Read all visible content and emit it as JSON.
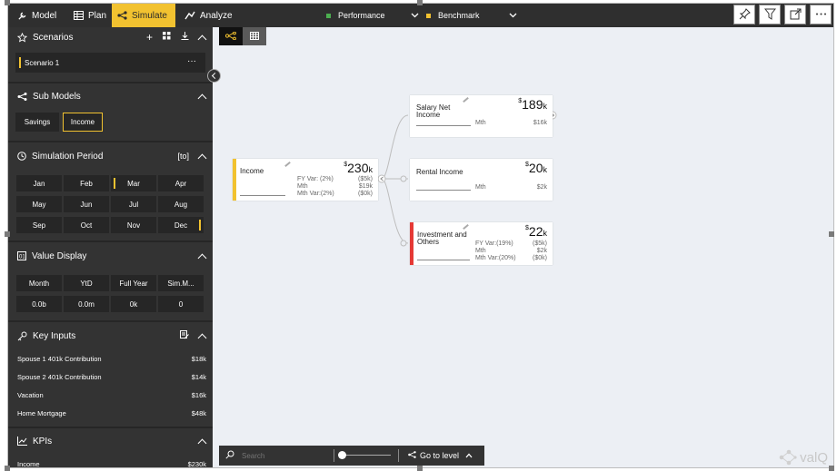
{
  "tabs": [
    {
      "label": "Model",
      "icon": "wrench-icon"
    },
    {
      "label": "Plan",
      "icon": "table-icon"
    },
    {
      "label": "Simulate",
      "icon": "simulate-icon",
      "active": true
    },
    {
      "label": "Analyze",
      "icon": "analyze-icon"
    }
  ],
  "scenario_selectors": [
    {
      "label": "Performance",
      "color": "#4caf50"
    },
    {
      "label": "Benchmark",
      "color": "#f2c230"
    }
  ],
  "toolbar_icons": [
    "pin-icon",
    "filter-icon",
    "expand-icon",
    "more-icon"
  ],
  "scenarios": {
    "title": "Scenarios",
    "item": "Scenario 1",
    "item_menu": "···"
  },
  "sub_models": {
    "title": "Sub Models",
    "items": [
      "Savings",
      "Income"
    ],
    "selected": "Income"
  },
  "simulation_period": {
    "title": "Simulation Period",
    "badge": "[to]",
    "months": [
      "Jan",
      "Feb",
      "Mar",
      "Apr",
      "May",
      "Jun",
      "Jul",
      "Aug",
      "Sep",
      "Oct",
      "Nov",
      "Dec"
    ],
    "range_start": "Mar",
    "range_end": "Dec"
  },
  "value_display": {
    "title": "Value Display",
    "headers": [
      "Month",
      "YtD",
      "Full Year",
      "Sim.M..."
    ],
    "values": [
      "0.0b",
      "0.0m",
      "0k",
      "0"
    ],
    "selected": "Full Year"
  },
  "key_inputs": {
    "title": "Key Inputs",
    "items": [
      {
        "label": "Spouse 1 401k Contribution",
        "value": "$18k"
      },
      {
        "label": "Spouse 2 401k Contribution",
        "value": "$14k"
      },
      {
        "label": "Vacation",
        "value": "$16k"
      },
      {
        "label": "Home Mortgage",
        "value": "$48k"
      }
    ]
  },
  "kpis": {
    "title": "KPIs",
    "items": [
      {
        "label": "Income",
        "value": "$230k"
      }
    ]
  },
  "nodes": {
    "income": {
      "name": "Income",
      "currency": "$",
      "value": "230",
      "unit": "k",
      "accent": "#f2c230",
      "rows": [
        {
          "label": "FY Var:  (2%)",
          "value": "($5k)"
        },
        {
          "label": "Mth",
          "value": "$19k"
        },
        {
          "label": "Mth Var:(2%)",
          "value": "($0k)"
        }
      ]
    },
    "salary": {
      "name": "Salary Net Income",
      "currency": "$",
      "value": "189",
      "unit": "k",
      "rows": [
        {
          "label": "Mth",
          "value": "$16k"
        }
      ]
    },
    "rental": {
      "name": "Rental Income",
      "currency": "$",
      "value": "20",
      "unit": "k",
      "rows": [
        {
          "label": "Mth",
          "value": "$2k"
        }
      ]
    },
    "investment": {
      "name": "Investment and Others",
      "currency": "$",
      "value": "22",
      "unit": "k",
      "accent": "#e53935",
      "rows": [
        {
          "label": "FY Var:(19%)",
          "value": "($5k)"
        },
        {
          "label": "Mth",
          "value": "$2k"
        },
        {
          "label": "Mth Var:(20%)",
          "value": "($0k)"
        }
      ]
    }
  },
  "bottom_bar": {
    "search_placeholder": "Search",
    "goto_label": "Go to level"
  },
  "logo_text": "valQ"
}
